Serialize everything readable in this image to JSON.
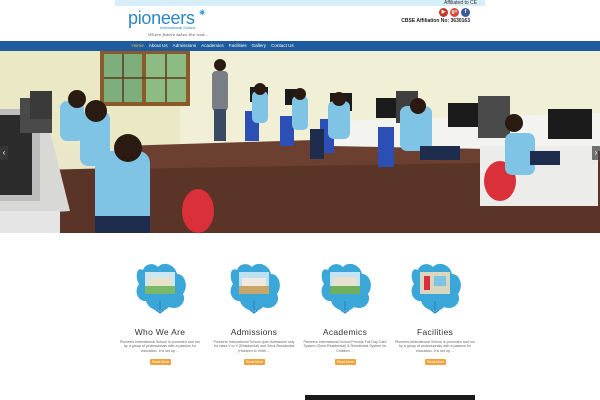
{
  "header": {
    "logo_text": "pioneers",
    "logo_sub": "International School",
    "logo_tagline": "Where future takes the root...",
    "affiliated": "Affiliated to CE",
    "cbse": "CBSE Affiliation No: 3630163",
    "social": [
      {
        "name": "youtube-icon",
        "glyph": "▶"
      },
      {
        "name": "google-plus-icon",
        "glyph": "g+"
      },
      {
        "name": "facebook-icon",
        "glyph": "f"
      }
    ]
  },
  "nav": {
    "items": [
      {
        "label": "Home",
        "active": true
      },
      {
        "label": "About Us",
        "active": false
      },
      {
        "label": "Admissions",
        "active": false
      },
      {
        "label": "Academics",
        "active": false
      },
      {
        "label": "Facilities",
        "active": false
      },
      {
        "label": "Gallery",
        "active": false
      },
      {
        "label": "Contact Us",
        "active": false
      }
    ]
  },
  "slider": {
    "prev_glyph": "‹",
    "next_glyph": "›"
  },
  "features": [
    {
      "title": "Who We Are",
      "desc": "Pioneers International School is promoted and run by a group of professionals with a passion for education. It is set up ...",
      "read_more": "Read More"
    },
    {
      "title": "Admissions",
      "desc": "Pioneers International School open Admission only for class V to X (Residential) and Semi-Residential (Hosteen to VIIIth ...",
      "read_more": "Read More"
    },
    {
      "title": "Academics",
      "desc": "Pioneers International School Provide Full Day Care System (Semi-Residential) & Residential System for Children ...",
      "read_more": "Read More"
    },
    {
      "title": "Facilities",
      "desc": "Pioneers International School is promoted and run by a group of professionals with a passion for education. It is set up ...",
      "read_more": "Read More"
    }
  ],
  "colors": {
    "nav_bg": "#1e5c9e",
    "accent": "#f0a33c",
    "logo_blue": "#2d86c6"
  }
}
